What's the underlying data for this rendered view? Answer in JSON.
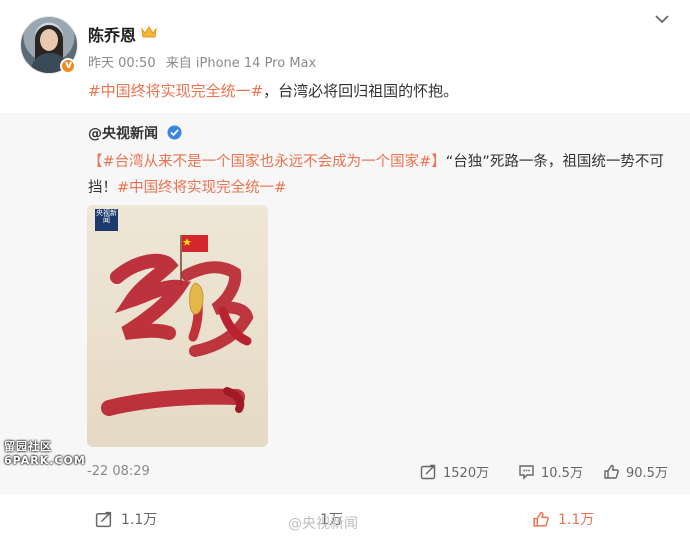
{
  "post": {
    "author": "陈乔恩",
    "time": "昨天 00:50",
    "source": "来自 iPhone 14 Pro Max",
    "hashtag": "#中国终将实现完全统一#",
    "text_rest": "，台湾必将回归祖国的怀抱。"
  },
  "repost": {
    "author": "@央视新闻",
    "hashtag1": "【#台湾从来不是一个国家也永远不会成为一个国家#】",
    "text_mid": "“台独”死路一条，祖国统一势不可挡！",
    "hashtag2": "#中国终将实现完全统一#",
    "poster_logo": "央视新闻",
    "timestamp": "-22 08:29",
    "stats": {
      "reposts": "1520万",
      "comments": "10.5万",
      "likes": "90.5万"
    }
  },
  "footer": {
    "reposts": "1.1万",
    "comments": "1万",
    "likes": "1.1万"
  },
  "watermark": {
    "site_line1": "留园社区",
    "site_line2": "6PARK.COM",
    "weibo": "@央视新闻"
  },
  "colors": {
    "accent": "#eb7350",
    "poster_red": "#b8232f",
    "poster_bg": "#ebe1cf"
  }
}
